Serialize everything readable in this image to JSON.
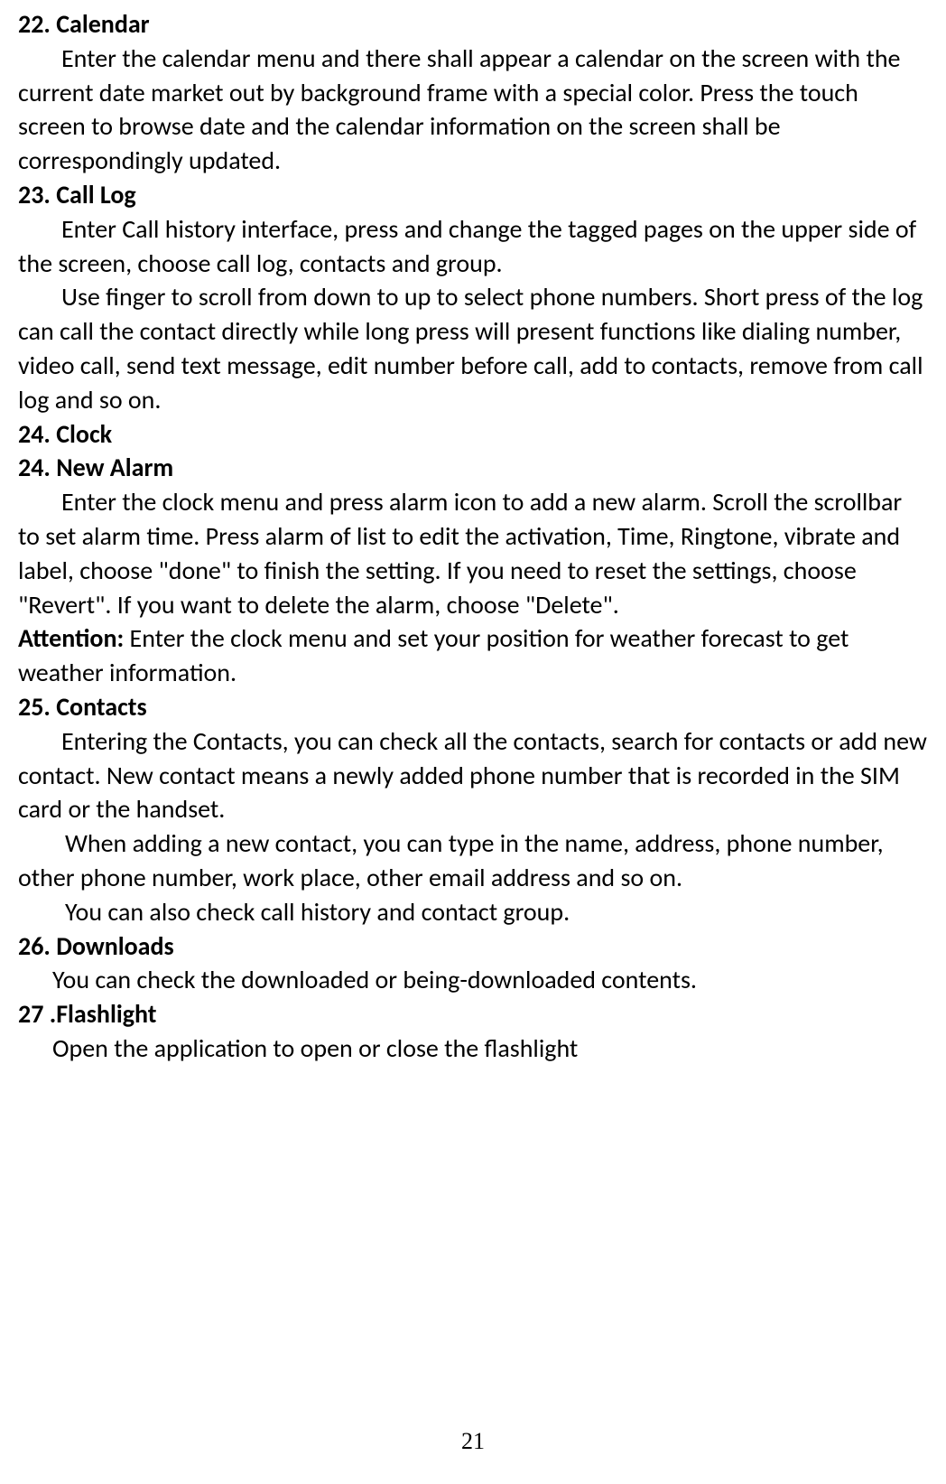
{
  "sections": {
    "s22": {
      "heading": "22. Calendar",
      "p1": "Enter the calendar menu and there shall appear a calendar on the screen with the current date market out by background frame with a special color. Press the touch screen to browse date and the calendar information on the screen shall be correspondingly updated."
    },
    "s23": {
      "heading": "23. Call Log",
      "p1": "Enter Call history interface, press and change the tagged pages on the upper side of the screen, choose call log, contacts and group.",
      "p2": "Use finger to scroll from down to up to select phone numbers. Short press of the log can call the contact directly while long press will present functions like dialing number, video call, send text message, edit number before call, add to contacts, remove from call log and so on."
    },
    "s24a": {
      "heading": "24. Clock"
    },
    "s24b": {
      "heading": "24. New Alarm",
      "p1": "Enter the clock menu and press alarm icon to add a new alarm. Scroll the scrollbar to set alarm time. Press alarm of list to edit the activation, Time, Ringtone, vibrate and label, choose \"done\" to finish the setting. If you need to reset the settings, choose \"Revert\". If you want to delete the alarm, choose \"Delete\".",
      "attention_label": "Attention:",
      "attention_text": " Enter the clock menu and set your position for weather forecast to get weather information."
    },
    "s25": {
      "heading": "25. Contacts",
      "p1": "Entering the Contacts, you can check all the contacts, search for contacts or add new contact. New contact means a newly added phone number that is recorded in the SIM card or the handset.",
      "p2": "When adding a new contact, you can type in the name, address, phone number, other phone number, work place, other email address and so on.",
      "p3": "You can also check call history and contact group."
    },
    "s26": {
      "heading": "26. Downloads",
      "p1": "You can check the downloaded or being-downloaded contents."
    },
    "s27": {
      "heading": "27 .Flashlight",
      "p1": "Open the application to open or close the flashlight"
    }
  },
  "page_number": "21"
}
